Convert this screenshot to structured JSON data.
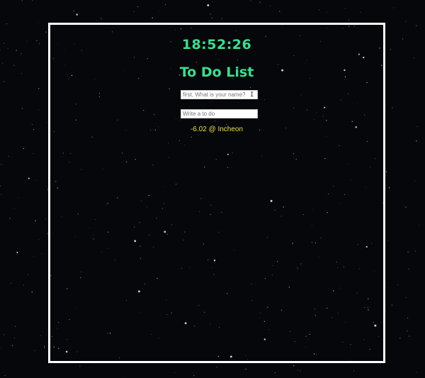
{
  "app": {
    "clock": "18:52:26",
    "title": "To Do List"
  },
  "form": {
    "name_placeholder": "first, What is your name?",
    "todo_placeholder": "Write a to do"
  },
  "weather": {
    "text": "-6.02 @ Incheon"
  },
  "colors": {
    "background": "#05070a",
    "accent": "#37e08f",
    "weather": "#e8e04a",
    "frame": "#ffffff"
  }
}
